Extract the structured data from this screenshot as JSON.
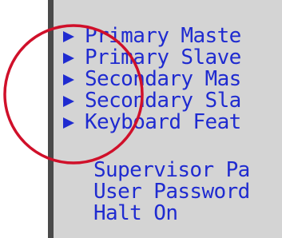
{
  "menu": {
    "items": [
      {
        "label": "Primary Maste",
        "icon": "triangle-right-icon"
      },
      {
        "label": "Primary Slave",
        "icon": "triangle-right-icon"
      },
      {
        "label": "Secondary Mas",
        "icon": "triangle-right-icon"
      },
      {
        "label": "Secondary Sla",
        "icon": "triangle-right-icon"
      },
      {
        "label": "Keyboard Feat",
        "icon": "triangle-right-icon"
      }
    ]
  },
  "settings": {
    "items": [
      {
        "label": "Supervisor Pa"
      },
      {
        "label": "User Password"
      },
      {
        "label": "Halt On"
      }
    ]
  },
  "colors": {
    "text": "#1f2bd0",
    "panel_background": "#d4d4d4",
    "panel_border": "#4a4a4a",
    "annotation_circle": "#d0102a"
  }
}
